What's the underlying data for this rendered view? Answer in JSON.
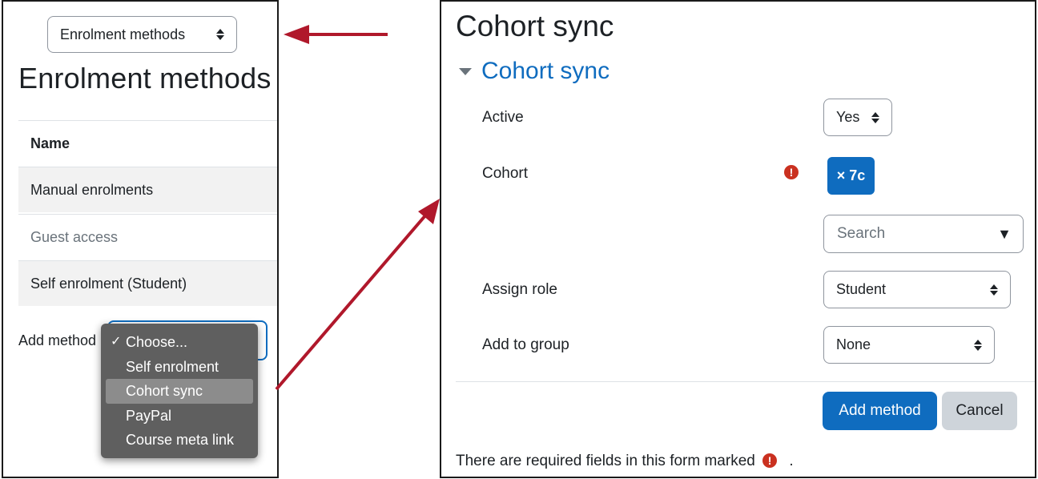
{
  "left": {
    "nav_select": "Enrolment methods",
    "heading": "Enrolment methods",
    "table": {
      "header": "Name",
      "rows": [
        "Manual enrolments",
        "Guest access",
        "Self enrolment (Student)"
      ]
    },
    "add_method_label": "Add method",
    "menu": {
      "check": "✓",
      "items": [
        "Choose...",
        "Self enrolment",
        "Cohort sync",
        "PayPal",
        "Course meta link"
      ],
      "selected": "Choose...",
      "highlighted": "Cohort sync"
    }
  },
  "right": {
    "heading": "Cohort sync",
    "section_title": "Cohort sync",
    "fields": {
      "active": {
        "label": "Active",
        "value": "Yes"
      },
      "cohort": {
        "label": "Cohort",
        "tag": "× 7c",
        "search_placeholder": "Search"
      },
      "assign_role": {
        "label": "Assign role",
        "value": "Student"
      },
      "add_to_group": {
        "label": "Add to group",
        "value": "None"
      }
    },
    "required_icon": "!",
    "buttons": {
      "add": "Add method",
      "cancel": "Cancel"
    },
    "footer": {
      "text": "There are required fields in this form marked",
      "suffix": "."
    }
  },
  "colors": {
    "accent": "#0f6cbf",
    "arrow": "#b0182b",
    "required": "#ca3120"
  }
}
